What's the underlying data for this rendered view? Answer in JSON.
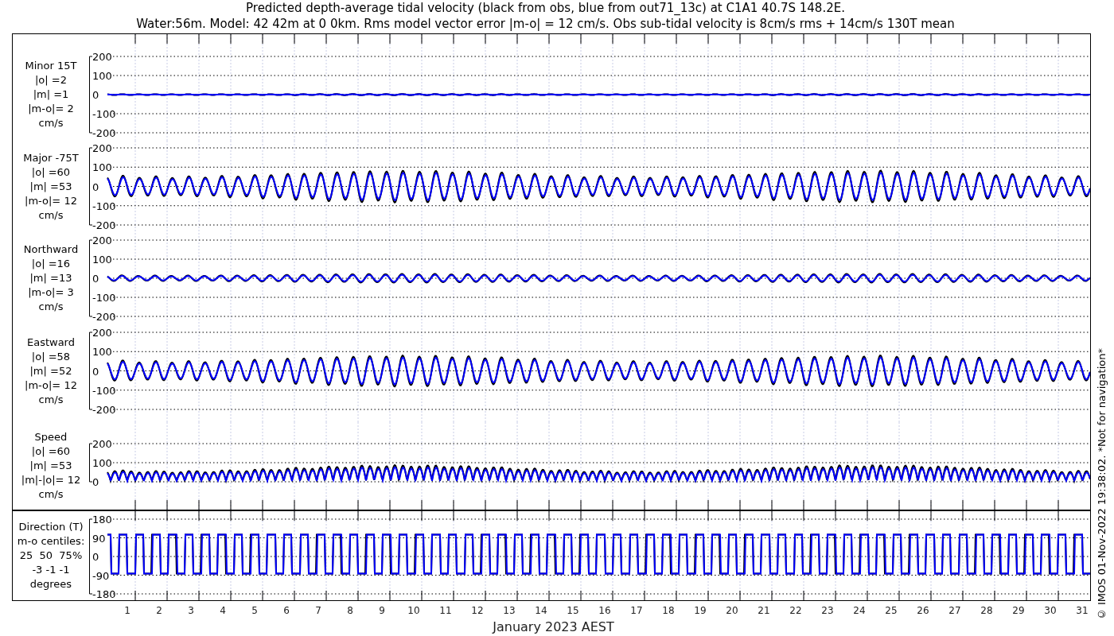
{
  "title": [
    "Predicted depth-average tidal velocity (black from obs, blue from out71_13c) at C1A1 40.7S 148.2E.",
    "Water:56m. Model: 42 42m at 0 0km. Rms model vector error |m-o| = 12 cm/s. Obs sub-tidal velocity is 8cm/s rms + 14cm/s 130T mean"
  ],
  "panels": [
    {
      "kind": "velocity",
      "label": [
        "Minor 15T",
        "|o| =2",
        "|m| =1",
        "|m-o|= 2",
        "cm/s"
      ],
      "yticks": [
        "200",
        "100",
        "0",
        "-100",
        "-200"
      ]
    },
    {
      "kind": "velocity",
      "label": [
        "Major -75T",
        "|o| =60",
        "|m| =53",
        "|m-o|= 12",
        "cm/s"
      ],
      "yticks": [
        "200",
        "100",
        "0",
        "-100",
        "-200"
      ]
    },
    {
      "kind": "velocity",
      "label": [
        "Northward",
        "|o| =16",
        "|m| =13",
        "|m-o|= 3",
        "cm/s"
      ],
      "yticks": [
        "200",
        "100",
        "0",
        "-100",
        "-200"
      ]
    },
    {
      "kind": "velocity",
      "label": [
        "Eastward",
        "|o| =58",
        "|m| =52",
        "|m-o|= 12",
        "cm/s"
      ],
      "yticks": [
        "200",
        "100",
        "0",
        "-100",
        "-200"
      ]
    },
    {
      "kind": "speed",
      "label": [
        "Speed",
        "|o| =60",
        "|m| =53",
        "|m|-|o|= 12",
        "cm/s"
      ],
      "yticks": [
        "200",
        "100",
        "0"
      ]
    }
  ],
  "direction_panel": {
    "kind": "direction",
    "label": [
      "Direction (T)",
      "m-o centiles:",
      "25  50  75%",
      "-3 -1 -1",
      "degrees"
    ],
    "yticks": [
      "180",
      "90",
      "0",
      "-90",
      "-180"
    ]
  },
  "xticks": [
    "1",
    "2",
    "3",
    "4",
    "5",
    "6",
    "7",
    "8",
    "9",
    "10",
    "11",
    "12",
    "13",
    "14",
    "15",
    "16",
    "17",
    "18",
    "19",
    "20",
    "21",
    "22",
    "23",
    "24",
    "25",
    "26",
    "27",
    "28",
    "29",
    "30",
    "31"
  ],
  "xlabel": "January 2023 AEST",
  "side_note": "© IMOS 01-Nov-2022 19:38:02. *Not for navigation*"
}
